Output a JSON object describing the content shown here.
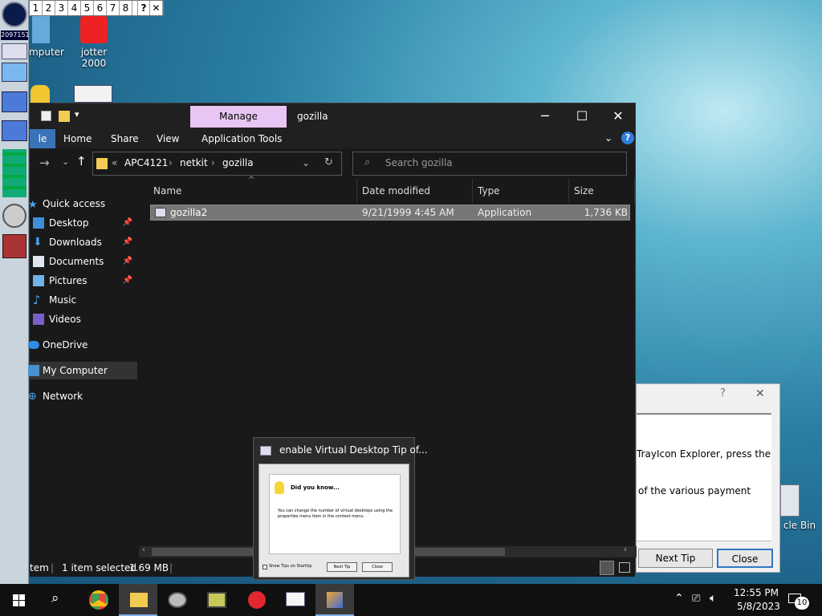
{
  "desktop": {
    "icons": [
      {
        "label": "mputer"
      },
      {
        "label": "jotter 2000"
      },
      {
        "label": "cle Bin"
      }
    ],
    "counter": "2097151",
    "vdesk_buttons": [
      "1",
      "2",
      "3",
      "4",
      "5",
      "6",
      "7",
      "8",
      "?",
      "✕"
    ]
  },
  "explorer": {
    "manage_tab": "Manage",
    "title": "gozilla",
    "ribbon_tabs": [
      "le",
      "Home",
      "Share",
      "View",
      "Application Tools"
    ],
    "address": {
      "sep": "«",
      "parts": [
        "APC4121",
        "netkit",
        "gozilla"
      ]
    },
    "search_placeholder": "Search gozilla",
    "nav": [
      {
        "label": "Quick access",
        "icon": "star-icon",
        "pin": false
      },
      {
        "label": "Desktop",
        "icon": "desktop-icon",
        "pin": true
      },
      {
        "label": "Downloads",
        "icon": "download-icon",
        "pin": true
      },
      {
        "label": "Documents",
        "icon": "document-icon",
        "pin": true
      },
      {
        "label": "Pictures",
        "icon": "picture-icon",
        "pin": true
      },
      {
        "label": "Music",
        "icon": "music-icon",
        "pin": false
      },
      {
        "label": "Videos",
        "icon": "video-icon",
        "pin": false
      },
      {
        "label": "OneDrive",
        "icon": "cloud-icon",
        "pin": false
      },
      {
        "label": "My Computer",
        "icon": "computer-icon",
        "pin": false,
        "selected": true
      },
      {
        "label": "Network",
        "icon": "network-icon",
        "pin": false
      }
    ],
    "columns": [
      "Name",
      "Date modified",
      "Type",
      "Size"
    ],
    "files": [
      {
        "name": "gozilla2",
        "date": "9/21/1999 4:45 AM",
        "type": "Application",
        "size": "1,736 KB"
      }
    ],
    "status": {
      "items": "tem",
      "selected": "1 item selected",
      "size": "1.69 MB"
    }
  },
  "tip_dialog": {
    "help": "?",
    "close": "✕",
    "line1": "TrayIcon Explorer, press the",
    "line2": "of the various payment",
    "next_tip": "Next Tip",
    "close_btn": "Close"
  },
  "vd_tip": {
    "title": "enable Virtual Desktop Tip of...",
    "heading": "Did you know...",
    "body": "You can change the number of virtual desktops using the properties menu item in the context menu.",
    "show_tips": "Show Tips on StartUp",
    "next_tip": "Next Tip",
    "close": "Close"
  },
  "taskbar": {
    "time": "12:55 PM",
    "date": "5/8/2023",
    "notifications": "10"
  }
}
